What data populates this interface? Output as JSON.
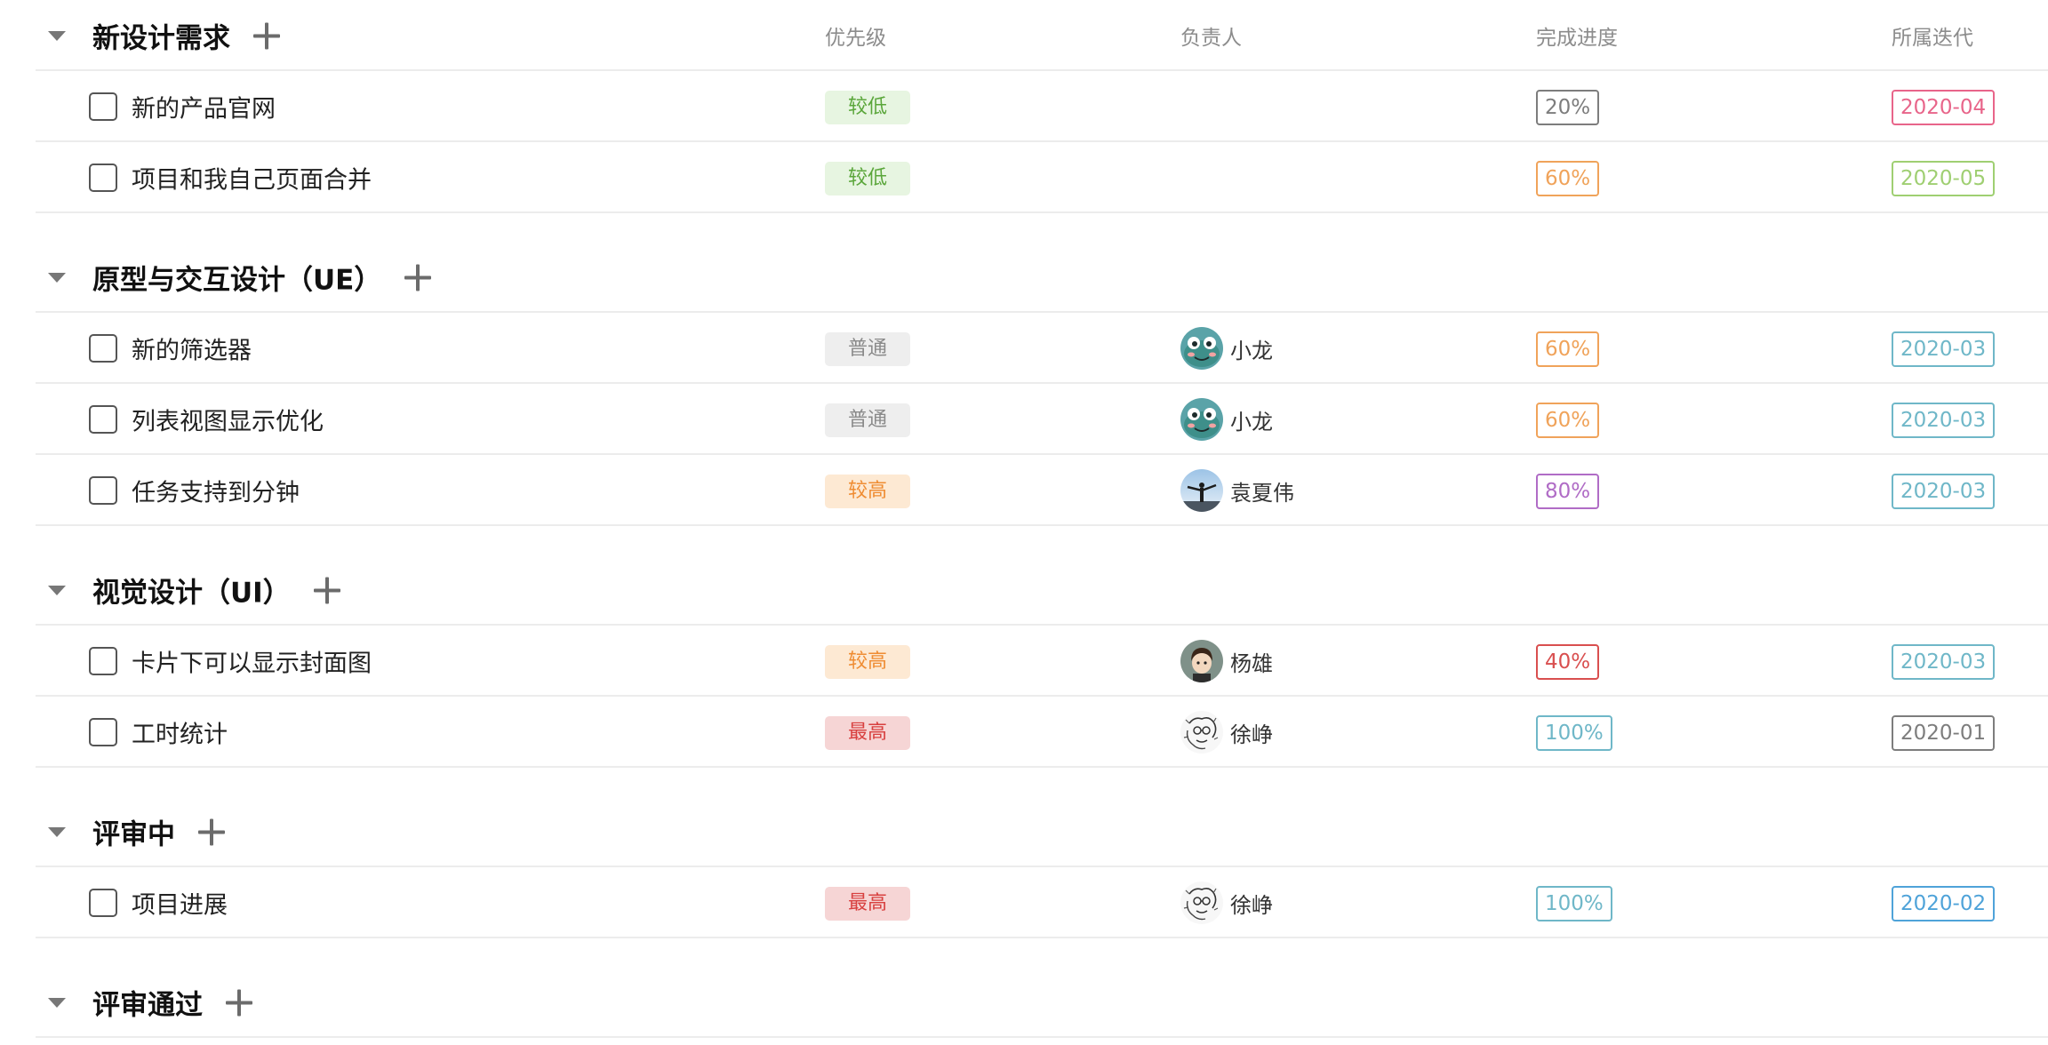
{
  "columns": {
    "priority": "优先级",
    "assignee": "负责人",
    "progress": "完成进度",
    "iteration": "所属迭代"
  },
  "colors": {
    "priority": {
      "较低": {
        "bg": "#e7f5e1",
        "fg": "#5aa63a"
      },
      "普通": {
        "bg": "#eeeeee",
        "fg": "#8a8a8a"
      },
      "较高": {
        "bg": "#fde9d3",
        "fg": "#ef8c32"
      },
      "最高": {
        "bg": "#f6d5d5",
        "fg": "#d8403f"
      }
    }
  },
  "groups": [
    {
      "title": "新设计需求",
      "show_columns": true,
      "tasks": [
        {
          "title": "新的产品官网",
          "priority": "较低",
          "assignee": "",
          "avatar": "",
          "progress": "20%",
          "progress_color": "#7d7d7d",
          "iteration": "2020-04",
          "iteration_color": "#e8658a"
        },
        {
          "title": "项目和我自己页面合并",
          "priority": "较低",
          "assignee": "",
          "avatar": "",
          "progress": "60%",
          "progress_color": "#f0a35a",
          "iteration": "2020-05",
          "iteration_color": "#9fcf72"
        }
      ]
    },
    {
      "title": "原型与交互设计（UE）",
      "show_columns": false,
      "tasks": [
        {
          "title": "新的筛选器",
          "priority": "普通",
          "assignee": "小龙",
          "avatar": "frog-avatar",
          "progress": "60%",
          "progress_color": "#f0a35a",
          "iteration": "2020-03",
          "iteration_color": "#6fb7c8"
        },
        {
          "title": "列表视图显示优化",
          "priority": "普通",
          "assignee": "小龙",
          "avatar": "frog-avatar",
          "progress": "60%",
          "progress_color": "#f0a35a",
          "iteration": "2020-03",
          "iteration_color": "#6fb7c8"
        },
        {
          "title": "任务支持到分钟",
          "priority": "较高",
          "assignee": "袁夏伟",
          "avatar": "photo-avatar",
          "progress": "80%",
          "progress_color": "#b06cc6",
          "iteration": "2020-03",
          "iteration_color": "#6fb7c8"
        }
      ]
    },
    {
      "title": "视觉设计（UI）",
      "show_columns": false,
      "tasks": [
        {
          "title": "卡片下可以显示封面图",
          "priority": "较高",
          "assignee": "杨雄",
          "avatar": "cartoon-avatar",
          "progress": "40%",
          "progress_color": "#d94f4f",
          "iteration": "2020-03",
          "iteration_color": "#6fb7c8"
        },
        {
          "title": "工时统计",
          "priority": "最高",
          "assignee": "徐峥",
          "avatar": "sketch-avatar",
          "progress": "100%",
          "progress_color": "#6fb7c8",
          "iteration": "2020-01",
          "iteration_color": "#7d7d7d"
        }
      ]
    },
    {
      "title": "评审中",
      "show_columns": false,
      "tasks": [
        {
          "title": "项目进展",
          "priority": "最高",
          "assignee": "徐峥",
          "avatar": "sketch-avatar",
          "progress": "100%",
          "progress_color": "#6fb7c8",
          "iteration": "2020-02",
          "iteration_color": "#4fa3d9"
        }
      ]
    },
    {
      "title": "评审通过",
      "show_columns": false,
      "tasks": []
    }
  ]
}
